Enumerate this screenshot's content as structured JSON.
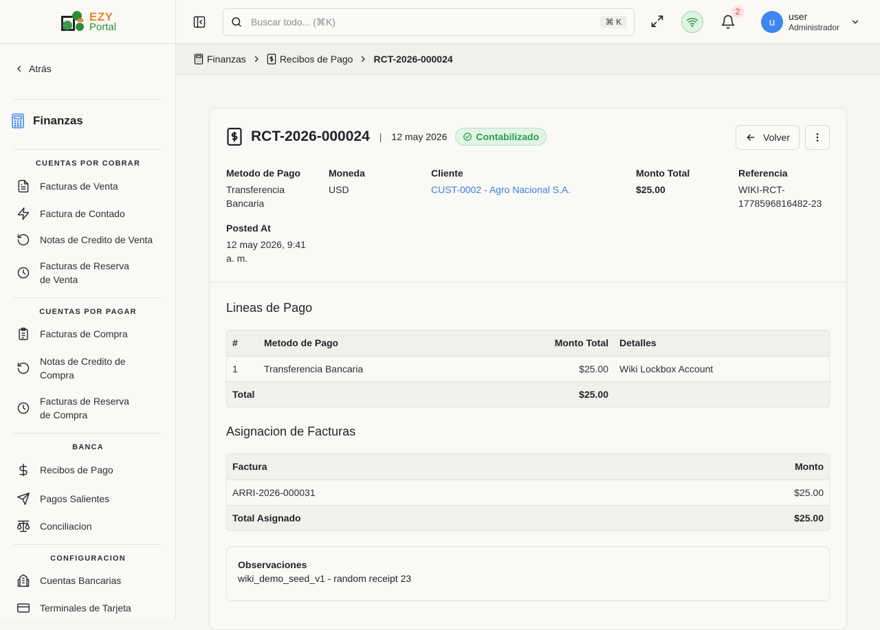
{
  "brand": {
    "line1": "EZY",
    "line2": "Portal"
  },
  "sidebar": {
    "back_label": "Atrás",
    "section_title": "Finanzas",
    "groups": [
      {
        "label": "CUENTAS POR COBRAR",
        "items": [
          {
            "label": "Facturas de Venta",
            "icon": "file-text-icon"
          },
          {
            "label": "Factura de Contado",
            "icon": "zap-icon"
          },
          {
            "label": "Notas de Credito de Venta",
            "icon": "rotate-ccw-icon"
          },
          {
            "label": "Facturas de Reserva de Venta",
            "icon": "clock-icon"
          }
        ]
      },
      {
        "label": "CUENTAS POR PAGAR",
        "items": [
          {
            "label": "Facturas de Compra",
            "icon": "clipboard-list-icon"
          },
          {
            "label": "Notas de Credito de Compra",
            "icon": "rotate-ccw-icon"
          },
          {
            "label": "Facturas de Reserva de Compra",
            "icon": "clock-icon"
          }
        ]
      },
      {
        "label": "BANCA",
        "items": [
          {
            "label": "Recibos de Pago",
            "icon": "dollar-icon"
          },
          {
            "label": "Pagos Salientes",
            "icon": "send-icon"
          },
          {
            "label": "Conciliacion",
            "icon": "scale-icon"
          }
        ]
      },
      {
        "label": "CONFIGURACION",
        "items": [
          {
            "label": "Cuentas Bancarias",
            "icon": "bank-icon"
          },
          {
            "label": "Terminales de Tarjeta",
            "icon": "credit-card-icon"
          }
        ]
      }
    ]
  },
  "header": {
    "search_placeholder": "Buscar todo... (⌘K)",
    "shortcut": "⌘ K",
    "notification_count": "2",
    "user_initial": "u",
    "user_name": "user",
    "user_role": "Administrador"
  },
  "breadcrumb": [
    "Finanzas",
    "Recibos de Pago",
    "RCT-2026-000024"
  ],
  "receipt": {
    "number": "RCT-2026-000024",
    "separator": "|",
    "date": "12 may 2026",
    "status": "Contabilizado",
    "back_button": "Volver",
    "fields": {
      "payment_method_label": "Metodo de Pago",
      "payment_method_line1": "Transferencia",
      "payment_method_line2": "Bancaria",
      "currency_label": "Moneda",
      "currency": "USD",
      "customer_label": "Cliente",
      "customer": "CUST-0002 - Agro Nacional S.A.",
      "total_label": "Monto Total",
      "total": "$25.00",
      "reference_label": "Referencia",
      "reference_line1": "WIKI-RCT-",
      "reference_line2": "1778596816482-23",
      "posted_label": "Posted At",
      "posted_line1": "12 may 2026, 9:41",
      "posted_line2": "a. m."
    },
    "payment_lines": {
      "title": "Lineas de Pago",
      "headers": [
        "#",
        "Metodo de Pago",
        "Monto Total",
        "Detalles"
      ],
      "rows": [
        [
          "1",
          "Transferencia Bancaria",
          "$25.00",
          "Wiki Lockbox Account"
        ]
      ],
      "total_label": "Total",
      "total_value": "$25.00"
    },
    "allocations": {
      "title": "Asignacion de Facturas",
      "headers": [
        "Factura",
        "Monto"
      ],
      "rows": [
        [
          "ARRI-2026-000031",
          "$25.00"
        ]
      ],
      "total_label": "Total Asignado",
      "total_value": "$25.00"
    },
    "notes": {
      "label": "Observaciones",
      "text": "wiki_demo_seed_v1 - random receipt 23"
    }
  },
  "colors": {
    "accent": "#3f86f0",
    "success": "#2f9c4d",
    "link": "#3b7de0",
    "danger": "#d9403a"
  }
}
